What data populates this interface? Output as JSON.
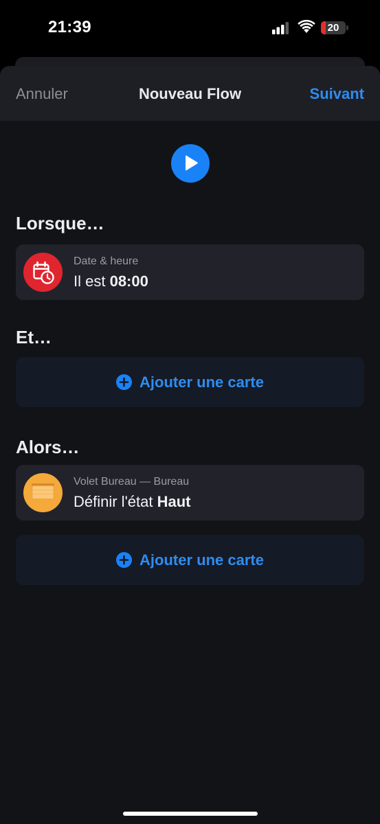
{
  "status_bar": {
    "time": "21:39",
    "battery_level": "20",
    "battery_fraction": 0.2,
    "icons": [
      "signal-icon",
      "wifi-icon",
      "battery-icon"
    ]
  },
  "nav": {
    "cancel_label": "Annuler",
    "title": "Nouveau Flow",
    "next_label": "Suivant"
  },
  "play_icon": "play-icon",
  "sections": {
    "when": {
      "title": "Lorsque…",
      "card": {
        "icon": "calendar-clock-icon",
        "icon_color": "#e0252f",
        "subtitle": "Date & heure",
        "text_prefix": "Il est ",
        "text_bold": "08:00"
      }
    },
    "and": {
      "title": "Et…",
      "add_label": "Ajouter une carte"
    },
    "then": {
      "title": "Alors…",
      "card": {
        "icon": "blind-icon",
        "icon_color": "#f5a93a",
        "subtitle": "Volet Bureau — Bureau",
        "text_prefix": "Définir l'état ",
        "text_bold": "Haut"
      },
      "add_label": "Ajouter une carte"
    }
  },
  "colors": {
    "accent": "#2f8cf0",
    "background": "#121317",
    "card": "#22232a"
  }
}
